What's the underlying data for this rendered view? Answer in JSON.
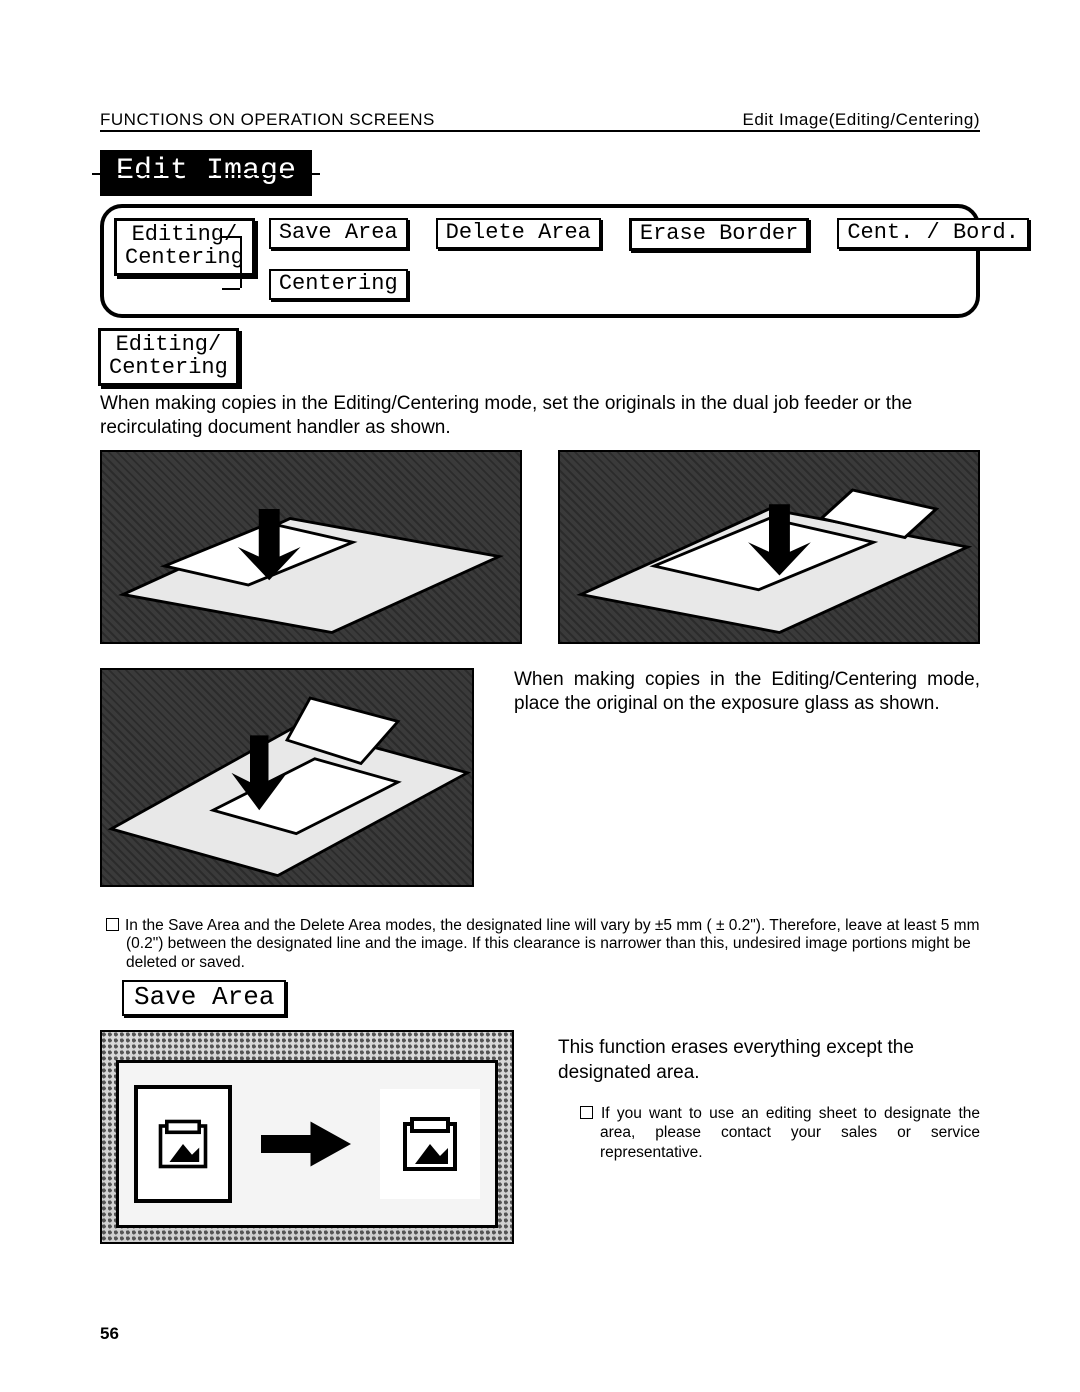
{
  "header": {
    "left": "FUNCTIONS ON OPERATION SCREENS",
    "right": "Edit Image(Editing/Centering)"
  },
  "tab_title": "Edit Image",
  "side_button": "Editing/\nCentering",
  "buttons": {
    "save_area": "Save Area",
    "delete_area": "Delete Area",
    "erase_border": "Erase Border",
    "cent_bord": "Cent. / Bord.",
    "centering": "Centering"
  },
  "side_button_2": "Editing/\nCentering",
  "para_intro": "When making copies in the Editing/Centering mode, set the originals in the dual job feeder or the recirculating document handler as shown.",
  "para_mid": "When making copies in the Editing/Centering mode, place the original on the exposure glass as shown.",
  "note_text": "In the Save Area and the Delete Area modes, the designated line will vary by ±5 mm ( ± 0.2\"). Therefore, leave at least 5 mm (0.2\") between the designated line and the image. If this clearance is narrower than this, undesired image portions might be deleted or saved.",
  "save_area_label": "Save Area",
  "save_para1": "This function erases everything except the designated area.",
  "save_para2": "If you want to use an editing sheet to designate the area, please contact your sales or service representative.",
  "page_number": "56"
}
